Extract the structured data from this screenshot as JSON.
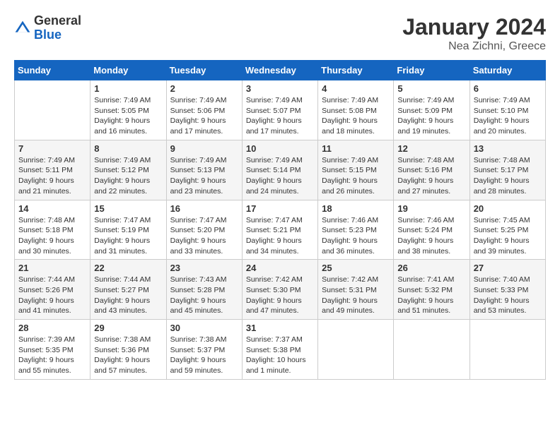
{
  "header": {
    "logo_general": "General",
    "logo_blue": "Blue",
    "month_title": "January 2024",
    "location": "Nea Zichni, Greece"
  },
  "days_of_week": [
    "Sunday",
    "Monday",
    "Tuesday",
    "Wednesday",
    "Thursday",
    "Friday",
    "Saturday"
  ],
  "weeks": [
    [
      {
        "day": "",
        "info": ""
      },
      {
        "day": "1",
        "info": "Sunrise: 7:49 AM\nSunset: 5:05 PM\nDaylight: 9 hours\nand 16 minutes."
      },
      {
        "day": "2",
        "info": "Sunrise: 7:49 AM\nSunset: 5:06 PM\nDaylight: 9 hours\nand 17 minutes."
      },
      {
        "day": "3",
        "info": "Sunrise: 7:49 AM\nSunset: 5:07 PM\nDaylight: 9 hours\nand 17 minutes."
      },
      {
        "day": "4",
        "info": "Sunrise: 7:49 AM\nSunset: 5:08 PM\nDaylight: 9 hours\nand 18 minutes."
      },
      {
        "day": "5",
        "info": "Sunrise: 7:49 AM\nSunset: 5:09 PM\nDaylight: 9 hours\nand 19 minutes."
      },
      {
        "day": "6",
        "info": "Sunrise: 7:49 AM\nSunset: 5:10 PM\nDaylight: 9 hours\nand 20 minutes."
      }
    ],
    [
      {
        "day": "7",
        "info": "Sunrise: 7:49 AM\nSunset: 5:11 PM\nDaylight: 9 hours\nand 21 minutes."
      },
      {
        "day": "8",
        "info": "Sunrise: 7:49 AM\nSunset: 5:12 PM\nDaylight: 9 hours\nand 22 minutes."
      },
      {
        "day": "9",
        "info": "Sunrise: 7:49 AM\nSunset: 5:13 PM\nDaylight: 9 hours\nand 23 minutes."
      },
      {
        "day": "10",
        "info": "Sunrise: 7:49 AM\nSunset: 5:14 PM\nDaylight: 9 hours\nand 24 minutes."
      },
      {
        "day": "11",
        "info": "Sunrise: 7:49 AM\nSunset: 5:15 PM\nDaylight: 9 hours\nand 26 minutes."
      },
      {
        "day": "12",
        "info": "Sunrise: 7:48 AM\nSunset: 5:16 PM\nDaylight: 9 hours\nand 27 minutes."
      },
      {
        "day": "13",
        "info": "Sunrise: 7:48 AM\nSunset: 5:17 PM\nDaylight: 9 hours\nand 28 minutes."
      }
    ],
    [
      {
        "day": "14",
        "info": "Sunrise: 7:48 AM\nSunset: 5:18 PM\nDaylight: 9 hours\nand 30 minutes."
      },
      {
        "day": "15",
        "info": "Sunrise: 7:47 AM\nSunset: 5:19 PM\nDaylight: 9 hours\nand 31 minutes."
      },
      {
        "day": "16",
        "info": "Sunrise: 7:47 AM\nSunset: 5:20 PM\nDaylight: 9 hours\nand 33 minutes."
      },
      {
        "day": "17",
        "info": "Sunrise: 7:47 AM\nSunset: 5:21 PM\nDaylight: 9 hours\nand 34 minutes."
      },
      {
        "day": "18",
        "info": "Sunrise: 7:46 AM\nSunset: 5:23 PM\nDaylight: 9 hours\nand 36 minutes."
      },
      {
        "day": "19",
        "info": "Sunrise: 7:46 AM\nSunset: 5:24 PM\nDaylight: 9 hours\nand 38 minutes."
      },
      {
        "day": "20",
        "info": "Sunrise: 7:45 AM\nSunset: 5:25 PM\nDaylight: 9 hours\nand 39 minutes."
      }
    ],
    [
      {
        "day": "21",
        "info": "Sunrise: 7:44 AM\nSunset: 5:26 PM\nDaylight: 9 hours\nand 41 minutes."
      },
      {
        "day": "22",
        "info": "Sunrise: 7:44 AM\nSunset: 5:27 PM\nDaylight: 9 hours\nand 43 minutes."
      },
      {
        "day": "23",
        "info": "Sunrise: 7:43 AM\nSunset: 5:28 PM\nDaylight: 9 hours\nand 45 minutes."
      },
      {
        "day": "24",
        "info": "Sunrise: 7:42 AM\nSunset: 5:30 PM\nDaylight: 9 hours\nand 47 minutes."
      },
      {
        "day": "25",
        "info": "Sunrise: 7:42 AM\nSunset: 5:31 PM\nDaylight: 9 hours\nand 49 minutes."
      },
      {
        "day": "26",
        "info": "Sunrise: 7:41 AM\nSunset: 5:32 PM\nDaylight: 9 hours\nand 51 minutes."
      },
      {
        "day": "27",
        "info": "Sunrise: 7:40 AM\nSunset: 5:33 PM\nDaylight: 9 hours\nand 53 minutes."
      }
    ],
    [
      {
        "day": "28",
        "info": "Sunrise: 7:39 AM\nSunset: 5:35 PM\nDaylight: 9 hours\nand 55 minutes."
      },
      {
        "day": "29",
        "info": "Sunrise: 7:38 AM\nSunset: 5:36 PM\nDaylight: 9 hours\nand 57 minutes."
      },
      {
        "day": "30",
        "info": "Sunrise: 7:38 AM\nSunset: 5:37 PM\nDaylight: 9 hours\nand 59 minutes."
      },
      {
        "day": "31",
        "info": "Sunrise: 7:37 AM\nSunset: 5:38 PM\nDaylight: 10 hours\nand 1 minute."
      },
      {
        "day": "",
        "info": ""
      },
      {
        "day": "",
        "info": ""
      },
      {
        "day": "",
        "info": ""
      }
    ]
  ]
}
